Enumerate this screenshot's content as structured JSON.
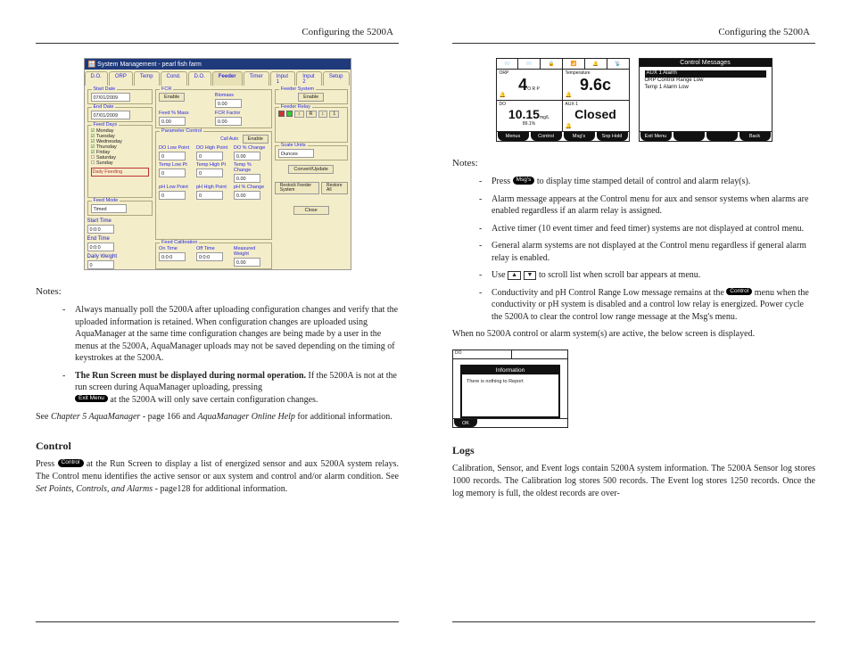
{
  "header_left": "Configuring the 5200A",
  "header_right": "Configuring the 5200A",
  "dialog": {
    "title": "System Management - pearl fish farm",
    "tabs": [
      "D.O.",
      "ORP",
      "Temp",
      "Cond.",
      "D.O.",
      "Feeder",
      "Timer",
      "Input 1",
      "Input 2",
      "Setup"
    ],
    "active_tab": "Feeder",
    "start_date_label": "Start Date",
    "start_date": "07/01/2009",
    "end_date_label": "End Date",
    "end_date": "07/01/2009",
    "feed_days_label": "Feed Days",
    "feed_days": [
      "Monday",
      "Tuesday",
      "Wednesday",
      "Thursday",
      "Friday",
      "Saturday",
      "Sunday"
    ],
    "daily_feeding": "Daily Feeding",
    "feed_mode_label": "Feed Mode",
    "feed_mode": "Timed",
    "start_time_label": "Start Time",
    "start_time": "0:0:0",
    "end_time_label": "End Time",
    "end_time": "0:0:0",
    "daily_weight_label": "Daily Weight",
    "daily_weight": "0",
    "fcr_label": "FCR",
    "fcr_enable": "Enable",
    "feed_pct_label": "Feed % Mass",
    "feed_pct": "0.00",
    "param_control": "Parameter Control",
    "do_low_point": "DO Low Point",
    "do_high_point": "DO High Point",
    "do_change": "DO % Change",
    "temp_low": "Temp Low Pt",
    "temp_high": "Temp High Pt",
    "temp_change": "Temp % Change",
    "ph_low": "pH Low Point",
    "ph_high": "pH High Point",
    "ph_change": "pH % Change",
    "feed_cal": "Feed Calibration",
    "on_time": "On Time",
    "off_time": "Off Time",
    "measured_wt": "Measured Weight",
    "biomass_label": "Biomass",
    "biomass": "0.00",
    "fcr_factor_label": "FCR Factor",
    "fcr_factor": "0.00",
    "call_auto": "Call Auto",
    "scale_units_label": "Scale Units",
    "scale_units": "Ounces",
    "feeder_sys": "Feeder System",
    "feeder_relay": "Feeder Relay",
    "enable": "Enable",
    "convert_update": "Convert/Update",
    "restock": "Restock Feeder System",
    "restore_all": "Restore All",
    "close": "Close",
    "zero": "0",
    "zero_dec": "0.00",
    "zero_time": "0:0:0"
  },
  "left_notes_h": "Notes:",
  "left_notes": {
    "n1a": "Always manually poll the 5200A after uploading configuration changes and verify that the uploaded information is retained.  When configuration changes are uploaded using AquaManager at the same time configuration changes are being made by a user  in the menus at the 5200A, AquaManager uploads may not be saved depending on the timing of keystrokes at the 5200A.",
    "n2_bold": "The Run Screen must be displayed during normal operation.",
    "n2_rest": "  If the 5200A is not at the run screen during AquaManager uploading, pressing",
    "n2_btn": "Exit Menu",
    "n2_after": " at the 5200A will only save certain configuration changes."
  },
  "left_see": {
    "pre": "See ",
    "it1": "Chapter 5 AquaManager",
    "mid1": " - page 166   and ",
    "it2": "AquaManager Online Help",
    "post": " for additional information."
  },
  "control_h": "Control",
  "left_press": {
    "pre": "Press ",
    "btn": "Control",
    "mid": " at the Run Screen to display a list of energized sensor and aux 5200A system relays.  The Control menu identifies the active sensor or aux system and control and/or alarm condition.  See ",
    "it": "Set Points, Controls, and Alarms",
    "post": " - page128 for additional information."
  },
  "lcd1": {
    "top_icons": [
      "📨",
      "📨",
      "🔒",
      "📶",
      "🔔",
      "📡"
    ],
    "orp_lbl": "ORP",
    "orp_val": "4",
    "orp_unit": "O R P",
    "temp_lbl": "Temperature",
    "temp_val": "9.6c",
    "do_lbl": "DO",
    "do_val": "10.15",
    "do_unit": "mg/L",
    "do_sub": "89.1%",
    "aux_lbl": "AUX 1",
    "aux_val": "Closed",
    "bot": [
      "Menus",
      "Control",
      "Msg's",
      "Snp Hold"
    ]
  },
  "lcd2": {
    "title": "Control Messages",
    "line_hi": "AUX 1 Alarm",
    "line2": "ORP Control Range Low",
    "line3": "Temp 1 Alarm Low",
    "bot": [
      "Exit Menu",
      "",
      "",
      "Back"
    ]
  },
  "right_notes_h": "Notes:",
  "right_notes": {
    "n1_pre": "Press ",
    "n1_btn": "Msg's",
    "n1_post": " to display time stamped detail of control and alarm relay(s).",
    "n2": "Alarm message appears at the Control menu for aux and sensor systems when alarms are enabled regardless if an alarm relay is assigned.",
    "n3": "Active timer (10 event timer and feed timer) systems are not displayed at control menu.",
    "n4": "General alarm systems are not displayed at the Control menu regardless if general alarm relay is enabled.",
    "n5_pre": "Use ",
    "n5_post": " to scroll list when scroll bar appears at menu.",
    "n6_pre": "Conductivity and pH Control Range Low message remains at the ",
    "n6_btn": "Control",
    "n6_post": " menu when the conductivity or pH system is disabled and a control low relay is energized.  Power cycle the 5200A to clear the control low range message at the Msg's menu."
  },
  "right_when": "When no 5200A control or alarm system(s) are active, the below screen is displayed.",
  "lcd3": {
    "do_lbl": "DO",
    "title": "Information",
    "text": "There is nothing to Report",
    "ok": "OK"
  },
  "logs_h": "Logs",
  "logs_para": "Calibration, Sensor, and Event logs contain 5200A system information. The 5200A Sensor log stores 1000 records.  The Calibration log stores 500 records.  The Event log stores 1250 records.  Once the log memory is full, the oldest records are over-"
}
